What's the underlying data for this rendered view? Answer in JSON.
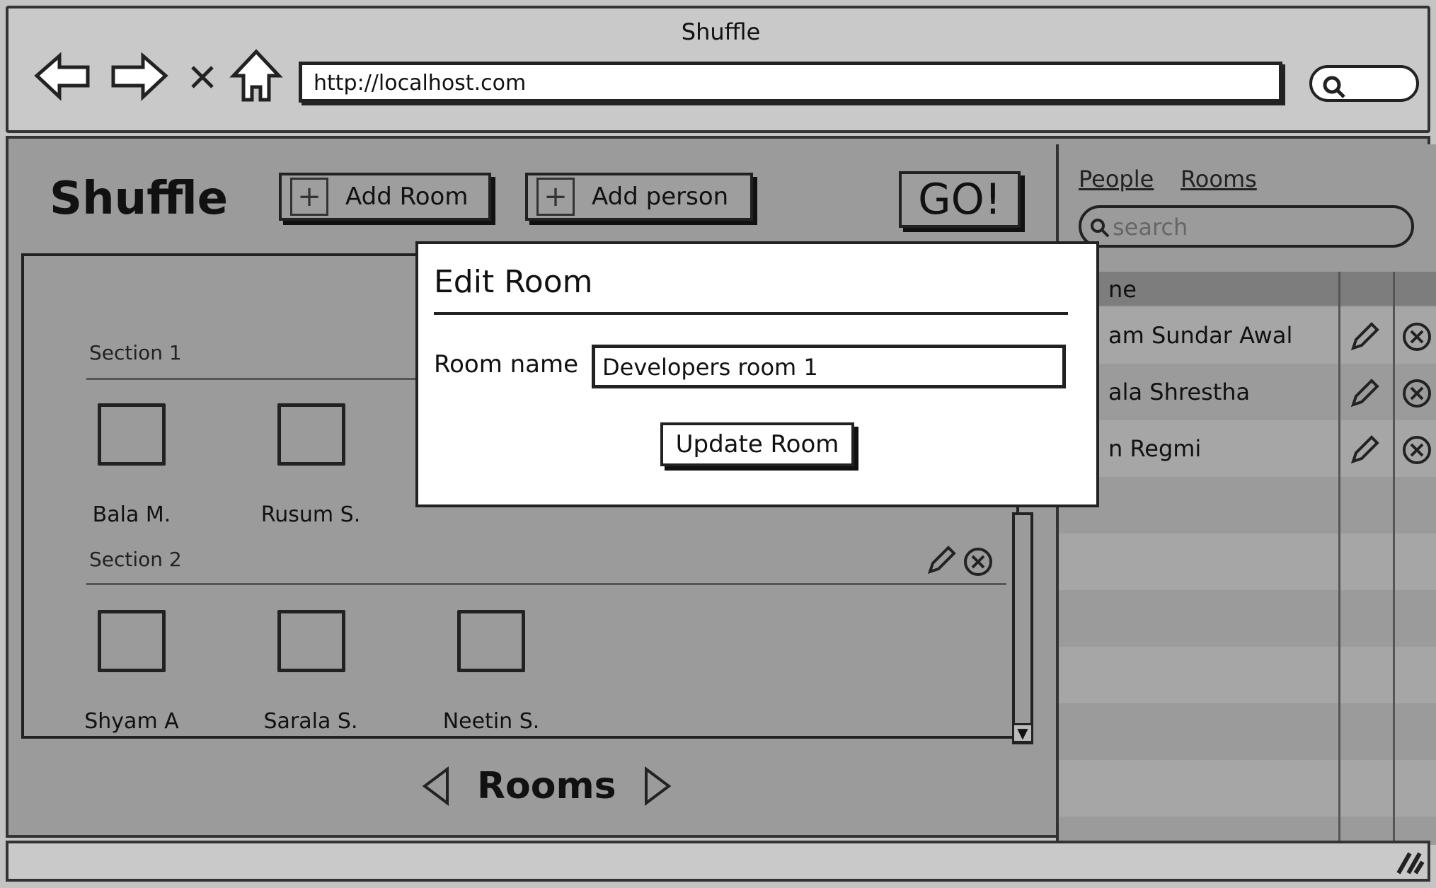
{
  "window": {
    "title": "Shuffle"
  },
  "browser": {
    "url": "http://localhost.com"
  },
  "app": {
    "title": "Shuffle",
    "add_room_label": "Add Room",
    "add_person_label": "Add person",
    "go_label": "GO!"
  },
  "sections": [
    {
      "label": "Section 1",
      "people": [
        "Bala M.",
        "Rusum S."
      ]
    },
    {
      "label": "Section 2",
      "people": [
        "Shyam A",
        "Sarala S.",
        "Neetin S."
      ]
    }
  ],
  "pager": {
    "label": "Rooms"
  },
  "right_panel": {
    "tabs": [
      "People",
      "Rooms"
    ],
    "search_placeholder": "search",
    "column_header": "ne",
    "rows": [
      "am Sundar Awal",
      "ala Shrestha",
      "n Regmi"
    ]
  },
  "modal": {
    "title": "Edit Room",
    "room_name_label": "Room name",
    "room_name_value": "Developers room 1",
    "update_label": "Update Room"
  }
}
